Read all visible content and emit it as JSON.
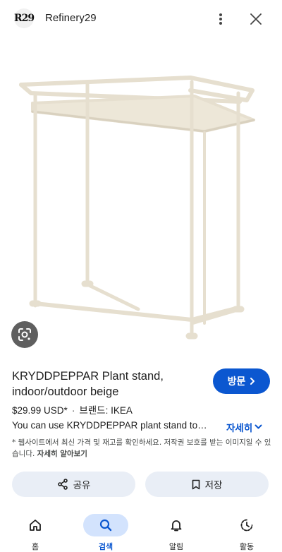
{
  "header": {
    "logo_text": "R29",
    "site_name": "Refinery29"
  },
  "product": {
    "title": "KRYDDPEPPAR Plant stand, indoor/outdoor beige",
    "price": "$29.99 USD*",
    "brand": "브랜드: IKEA",
    "description": "You can use KRYDDPEPPAR plant stand to…",
    "more_label": "자세히",
    "notice": "* 웹사이트에서 최신 가격 및 재고를 확인하세요. 저작권 보호를 받는 이미지일 수 있습니다.",
    "notice_link": "자세히 알아보기"
  },
  "buttons": {
    "visit": "방문",
    "share": "공유",
    "save": "저장"
  },
  "nav": [
    {
      "label": "홈",
      "icon": "home-icon"
    },
    {
      "label": "검색",
      "icon": "search-icon"
    },
    {
      "label": "알림",
      "icon": "bell-icon"
    },
    {
      "label": "활동",
      "icon": "activity-icon"
    }
  ],
  "colors": {
    "accent": "#0b57d0",
    "chip_bg": "#e9eef6",
    "active_nav_bg": "#d3e3fd",
    "product_color": "#ece6d8"
  }
}
